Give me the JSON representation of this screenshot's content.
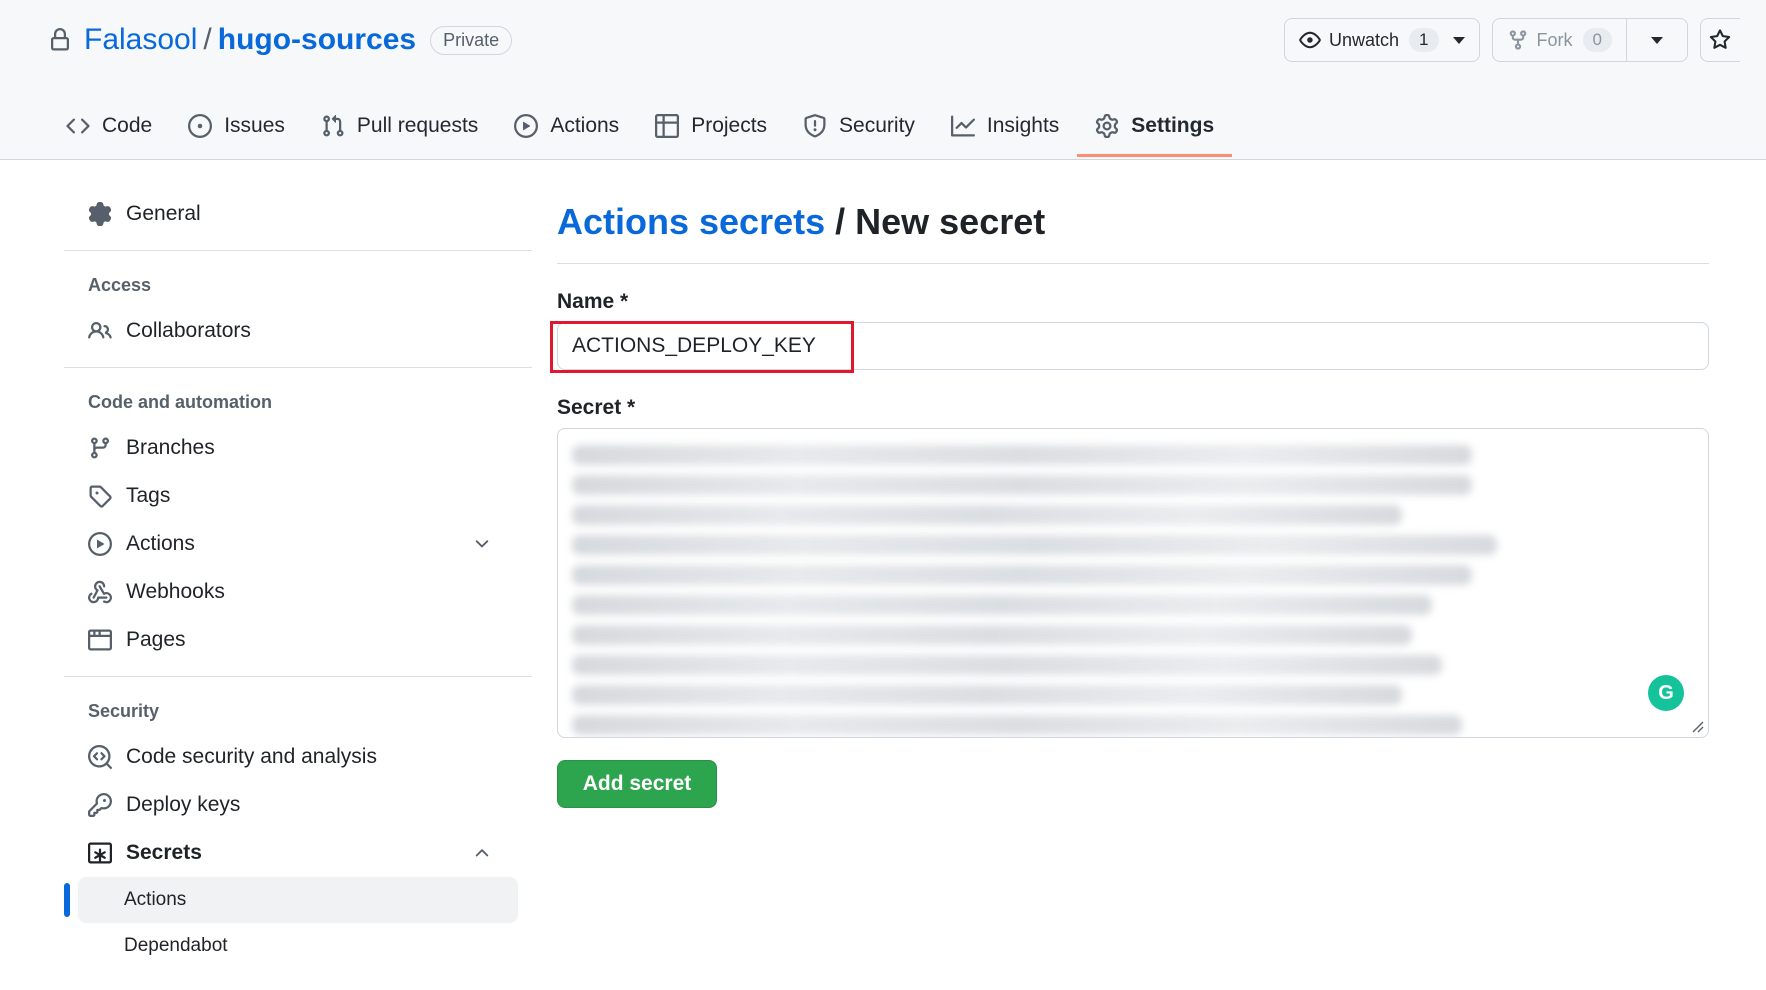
{
  "repo": {
    "owner": "Falasool",
    "separator": "/",
    "name": "hugo-sources",
    "visibility": "Private"
  },
  "header_actions": {
    "unwatch_label": "Unwatch",
    "unwatch_count": "1",
    "fork_label": "Fork",
    "fork_count": "0"
  },
  "tabs": [
    {
      "label": "Code",
      "icon": "code-icon"
    },
    {
      "label": "Issues",
      "icon": "issue-icon"
    },
    {
      "label": "Pull requests",
      "icon": "pull-request-icon"
    },
    {
      "label": "Actions",
      "icon": "play-icon"
    },
    {
      "label": "Projects",
      "icon": "table-icon"
    },
    {
      "label": "Security",
      "icon": "shield-icon"
    },
    {
      "label": "Insights",
      "icon": "graph-icon"
    },
    {
      "label": "Settings",
      "icon": "gear-icon",
      "selected": true
    }
  ],
  "sidebar": {
    "general": "General",
    "access_heading": "Access",
    "collaborators": "Collaborators",
    "code_heading": "Code and automation",
    "branches": "Branches",
    "tags": "Tags",
    "actions": "Actions",
    "webhooks": "Webhooks",
    "pages": "Pages",
    "security_heading": "Security",
    "code_security": "Code security and analysis",
    "deploy_keys": "Deploy keys",
    "secrets": "Secrets",
    "secrets_actions": "Actions",
    "secrets_dependabot": "Dependabot"
  },
  "main": {
    "breadcrumb_link": "Actions secrets",
    "breadcrumb_sep": "/",
    "title": "New secret",
    "name_label": "Name *",
    "name_value": "ACTIONS_DEPLOY_KEY",
    "secret_label": "Secret *",
    "submit_label": "Add secret",
    "grammarly_glyph": "G"
  },
  "colors": {
    "link": "#0969da",
    "primary_button": "#2da44e",
    "selected_tab_underline": "#fd8c73",
    "highlight_box": "#e0182d"
  }
}
